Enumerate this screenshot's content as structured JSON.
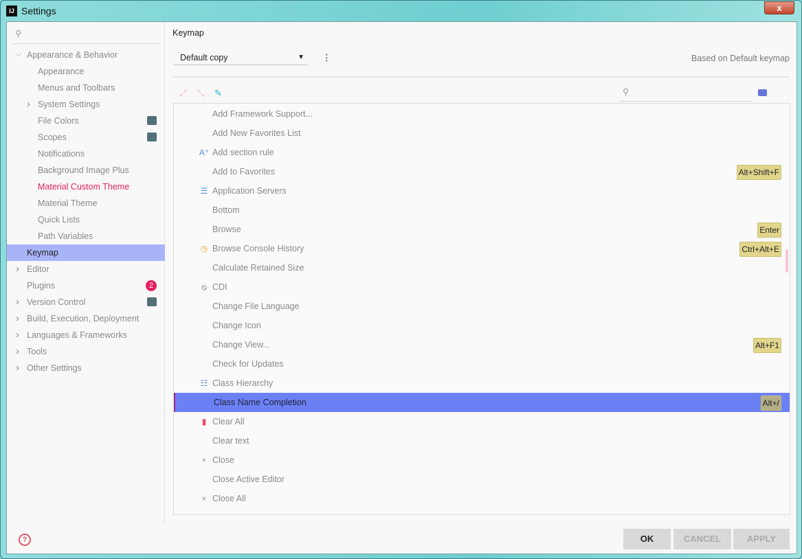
{
  "window": {
    "title": "Settings",
    "logo": "IJ",
    "close": "x"
  },
  "sidebar": {
    "search_placeholder": "",
    "items": [
      {
        "label": "Appearance & Behavior",
        "level": 0,
        "arrow": "expanded"
      },
      {
        "label": "Appearance",
        "level": 1
      },
      {
        "label": "Menus and Toolbars",
        "level": 1
      },
      {
        "label": "System Settings",
        "level": 1,
        "arrow": "collapsed"
      },
      {
        "label": "File Colors",
        "level": 1,
        "badge": "project-icon"
      },
      {
        "label": "Scopes",
        "level": 1,
        "badge": "project-icon"
      },
      {
        "label": "Notifications",
        "level": 1
      },
      {
        "label": "Background Image Plus",
        "level": 1
      },
      {
        "label": "Material Custom Theme",
        "level": 1,
        "highlight": "#e0245e"
      },
      {
        "label": "Material Theme",
        "level": 1
      },
      {
        "label": "Quick Lists",
        "level": 1
      },
      {
        "label": "Path Variables",
        "level": 1
      },
      {
        "label": "Keymap",
        "level": 0,
        "selected": true
      },
      {
        "label": "Editor",
        "level": 0,
        "arrow": "collapsed"
      },
      {
        "label": "Plugins",
        "level": 0,
        "count": "2"
      },
      {
        "label": "Version Control",
        "level": 0,
        "arrow": "collapsed",
        "badge": "project-icon"
      },
      {
        "label": "Build, Execution, Deployment",
        "level": 0,
        "arrow": "collapsed"
      },
      {
        "label": "Languages & Frameworks",
        "level": 0,
        "arrow": "collapsed"
      },
      {
        "label": "Tools",
        "level": 0,
        "arrow": "collapsed"
      },
      {
        "label": "Other Settings",
        "level": 0,
        "arrow": "collapsed"
      }
    ]
  },
  "main": {
    "title": "Keymap",
    "keymap_select": "Default copy",
    "based_on": "Based on Default keymap",
    "search_placeholder": "",
    "actions": [
      {
        "label": "Add Framework Support..."
      },
      {
        "label": "Add New Favorites List"
      },
      {
        "label": "Add section rule",
        "icon": "font-plus-icon"
      },
      {
        "label": "Add to Favorites",
        "shortcut": "Alt+Shift+F"
      },
      {
        "label": "Application Servers",
        "icon": "servers-icon"
      },
      {
        "label": "Bottom"
      },
      {
        "label": "Browse",
        "shortcut": "Enter"
      },
      {
        "label": "Browse Console History",
        "icon": "history-icon",
        "shortcut": "Ctrl+Alt+E"
      },
      {
        "label": "Calculate Retained Size"
      },
      {
        "label": "CDI",
        "icon": "cdi-icon"
      },
      {
        "label": "Change File Language"
      },
      {
        "label": "Change Icon"
      },
      {
        "label": "Change View...",
        "shortcut": "Alt+F1"
      },
      {
        "label": "Check for Updates"
      },
      {
        "label": "Class Hierarchy",
        "icon": "hierarchy-icon"
      },
      {
        "label": "Class Name Completion",
        "shortcut": "Alt+/",
        "selected": true
      },
      {
        "label": "Clear All",
        "icon": "trash-icon"
      },
      {
        "label": "Clear text"
      },
      {
        "label": "Close",
        "icon": "close-icon"
      },
      {
        "label": "Close Active Editor"
      },
      {
        "label": "Close All",
        "icon": "close-icon"
      }
    ]
  },
  "footer": {
    "ok": "OK",
    "cancel": "CANCEL",
    "apply": "APPLY",
    "help": "?"
  },
  "colors": {
    "selection": "#6c80f6",
    "sidebar_selection": "#a8b4f8",
    "shortcut_bg": "#e2d68c",
    "accent": "#e0245e"
  }
}
